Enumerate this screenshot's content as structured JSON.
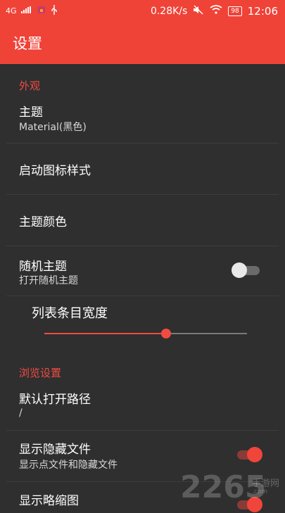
{
  "status_bar": {
    "network": "4G",
    "speed": "0.28K/s",
    "battery": "98",
    "time": "12:06"
  },
  "app_bar": {
    "title": "设置"
  },
  "sections": {
    "appearance": "外观",
    "browse": "浏览设置"
  },
  "items": {
    "theme": {
      "title": "主题",
      "subtitle": "Material(黑色)"
    },
    "launcher_icon": {
      "title": "启动图标样式"
    },
    "theme_color": {
      "title": "主题颜色"
    },
    "random_theme": {
      "title": "随机主题",
      "subtitle": "打开随机主题",
      "enabled": false
    },
    "list_width": {
      "title": "列表条目宽度",
      "value": 0.6
    },
    "default_path": {
      "title": "默认打开路径",
      "subtitle": "/"
    },
    "show_hidden": {
      "title": "显示隐藏文件",
      "subtitle": "显示点文件和隐藏文件",
      "enabled": true
    },
    "show_thumbnails": {
      "title": "显示略缩图",
      "enabled": true
    }
  },
  "watermark": {
    "brand": "2265",
    "sub": "手游网",
    "en": ".com"
  },
  "colors": {
    "accent": "#ef4338",
    "background": "#2f2f2f"
  },
  "icons": [
    "signal-icon",
    "usb-icon",
    "mute-icon",
    "wifi-icon",
    "battery-icon"
  ]
}
